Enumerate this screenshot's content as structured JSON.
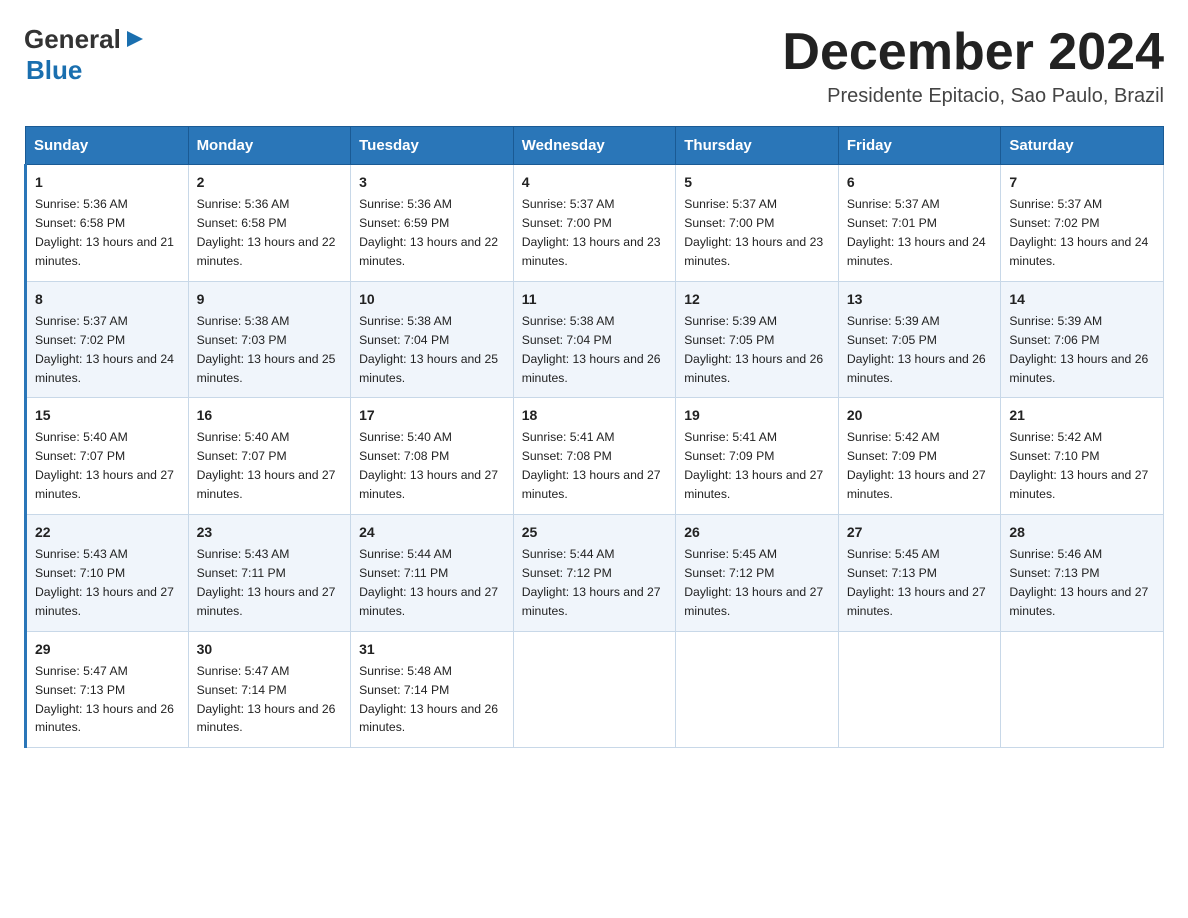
{
  "header": {
    "logo_general": "General",
    "logo_blue": "Blue",
    "month_title": "December 2024",
    "subtitle": "Presidente Epitacio, Sao Paulo, Brazil"
  },
  "days_of_week": [
    "Sunday",
    "Monday",
    "Tuesday",
    "Wednesday",
    "Thursday",
    "Friday",
    "Saturday"
  ],
  "weeks": [
    [
      {
        "day": "1",
        "sunrise": "5:36 AM",
        "sunset": "6:58 PM",
        "daylight": "13 hours and 21 minutes."
      },
      {
        "day": "2",
        "sunrise": "5:36 AM",
        "sunset": "6:58 PM",
        "daylight": "13 hours and 22 minutes."
      },
      {
        "day": "3",
        "sunrise": "5:36 AM",
        "sunset": "6:59 PM",
        "daylight": "13 hours and 22 minutes."
      },
      {
        "day": "4",
        "sunrise": "5:37 AM",
        "sunset": "7:00 PM",
        "daylight": "13 hours and 23 minutes."
      },
      {
        "day": "5",
        "sunrise": "5:37 AM",
        "sunset": "7:00 PM",
        "daylight": "13 hours and 23 minutes."
      },
      {
        "day": "6",
        "sunrise": "5:37 AM",
        "sunset": "7:01 PM",
        "daylight": "13 hours and 24 minutes."
      },
      {
        "day": "7",
        "sunrise": "5:37 AM",
        "sunset": "7:02 PM",
        "daylight": "13 hours and 24 minutes."
      }
    ],
    [
      {
        "day": "8",
        "sunrise": "5:37 AM",
        "sunset": "7:02 PM",
        "daylight": "13 hours and 24 minutes."
      },
      {
        "day": "9",
        "sunrise": "5:38 AM",
        "sunset": "7:03 PM",
        "daylight": "13 hours and 25 minutes."
      },
      {
        "day": "10",
        "sunrise": "5:38 AM",
        "sunset": "7:04 PM",
        "daylight": "13 hours and 25 minutes."
      },
      {
        "day": "11",
        "sunrise": "5:38 AM",
        "sunset": "7:04 PM",
        "daylight": "13 hours and 26 minutes."
      },
      {
        "day": "12",
        "sunrise": "5:39 AM",
        "sunset": "7:05 PM",
        "daylight": "13 hours and 26 minutes."
      },
      {
        "day": "13",
        "sunrise": "5:39 AM",
        "sunset": "7:05 PM",
        "daylight": "13 hours and 26 minutes."
      },
      {
        "day": "14",
        "sunrise": "5:39 AM",
        "sunset": "7:06 PM",
        "daylight": "13 hours and 26 minutes."
      }
    ],
    [
      {
        "day": "15",
        "sunrise": "5:40 AM",
        "sunset": "7:07 PM",
        "daylight": "13 hours and 27 minutes."
      },
      {
        "day": "16",
        "sunrise": "5:40 AM",
        "sunset": "7:07 PM",
        "daylight": "13 hours and 27 minutes."
      },
      {
        "day": "17",
        "sunrise": "5:40 AM",
        "sunset": "7:08 PM",
        "daylight": "13 hours and 27 minutes."
      },
      {
        "day": "18",
        "sunrise": "5:41 AM",
        "sunset": "7:08 PM",
        "daylight": "13 hours and 27 minutes."
      },
      {
        "day": "19",
        "sunrise": "5:41 AM",
        "sunset": "7:09 PM",
        "daylight": "13 hours and 27 minutes."
      },
      {
        "day": "20",
        "sunrise": "5:42 AM",
        "sunset": "7:09 PM",
        "daylight": "13 hours and 27 minutes."
      },
      {
        "day": "21",
        "sunrise": "5:42 AM",
        "sunset": "7:10 PM",
        "daylight": "13 hours and 27 minutes."
      }
    ],
    [
      {
        "day": "22",
        "sunrise": "5:43 AM",
        "sunset": "7:10 PM",
        "daylight": "13 hours and 27 minutes."
      },
      {
        "day": "23",
        "sunrise": "5:43 AM",
        "sunset": "7:11 PM",
        "daylight": "13 hours and 27 minutes."
      },
      {
        "day": "24",
        "sunrise": "5:44 AM",
        "sunset": "7:11 PM",
        "daylight": "13 hours and 27 minutes."
      },
      {
        "day": "25",
        "sunrise": "5:44 AM",
        "sunset": "7:12 PM",
        "daylight": "13 hours and 27 minutes."
      },
      {
        "day": "26",
        "sunrise": "5:45 AM",
        "sunset": "7:12 PM",
        "daylight": "13 hours and 27 minutes."
      },
      {
        "day": "27",
        "sunrise": "5:45 AM",
        "sunset": "7:13 PM",
        "daylight": "13 hours and 27 minutes."
      },
      {
        "day": "28",
        "sunrise": "5:46 AM",
        "sunset": "7:13 PM",
        "daylight": "13 hours and 27 minutes."
      }
    ],
    [
      {
        "day": "29",
        "sunrise": "5:47 AM",
        "sunset": "7:13 PM",
        "daylight": "13 hours and 26 minutes."
      },
      {
        "day": "30",
        "sunrise": "5:47 AM",
        "sunset": "7:14 PM",
        "daylight": "13 hours and 26 minutes."
      },
      {
        "day": "31",
        "sunrise": "5:48 AM",
        "sunset": "7:14 PM",
        "daylight": "13 hours and 26 minutes."
      },
      null,
      null,
      null,
      null
    ]
  ]
}
